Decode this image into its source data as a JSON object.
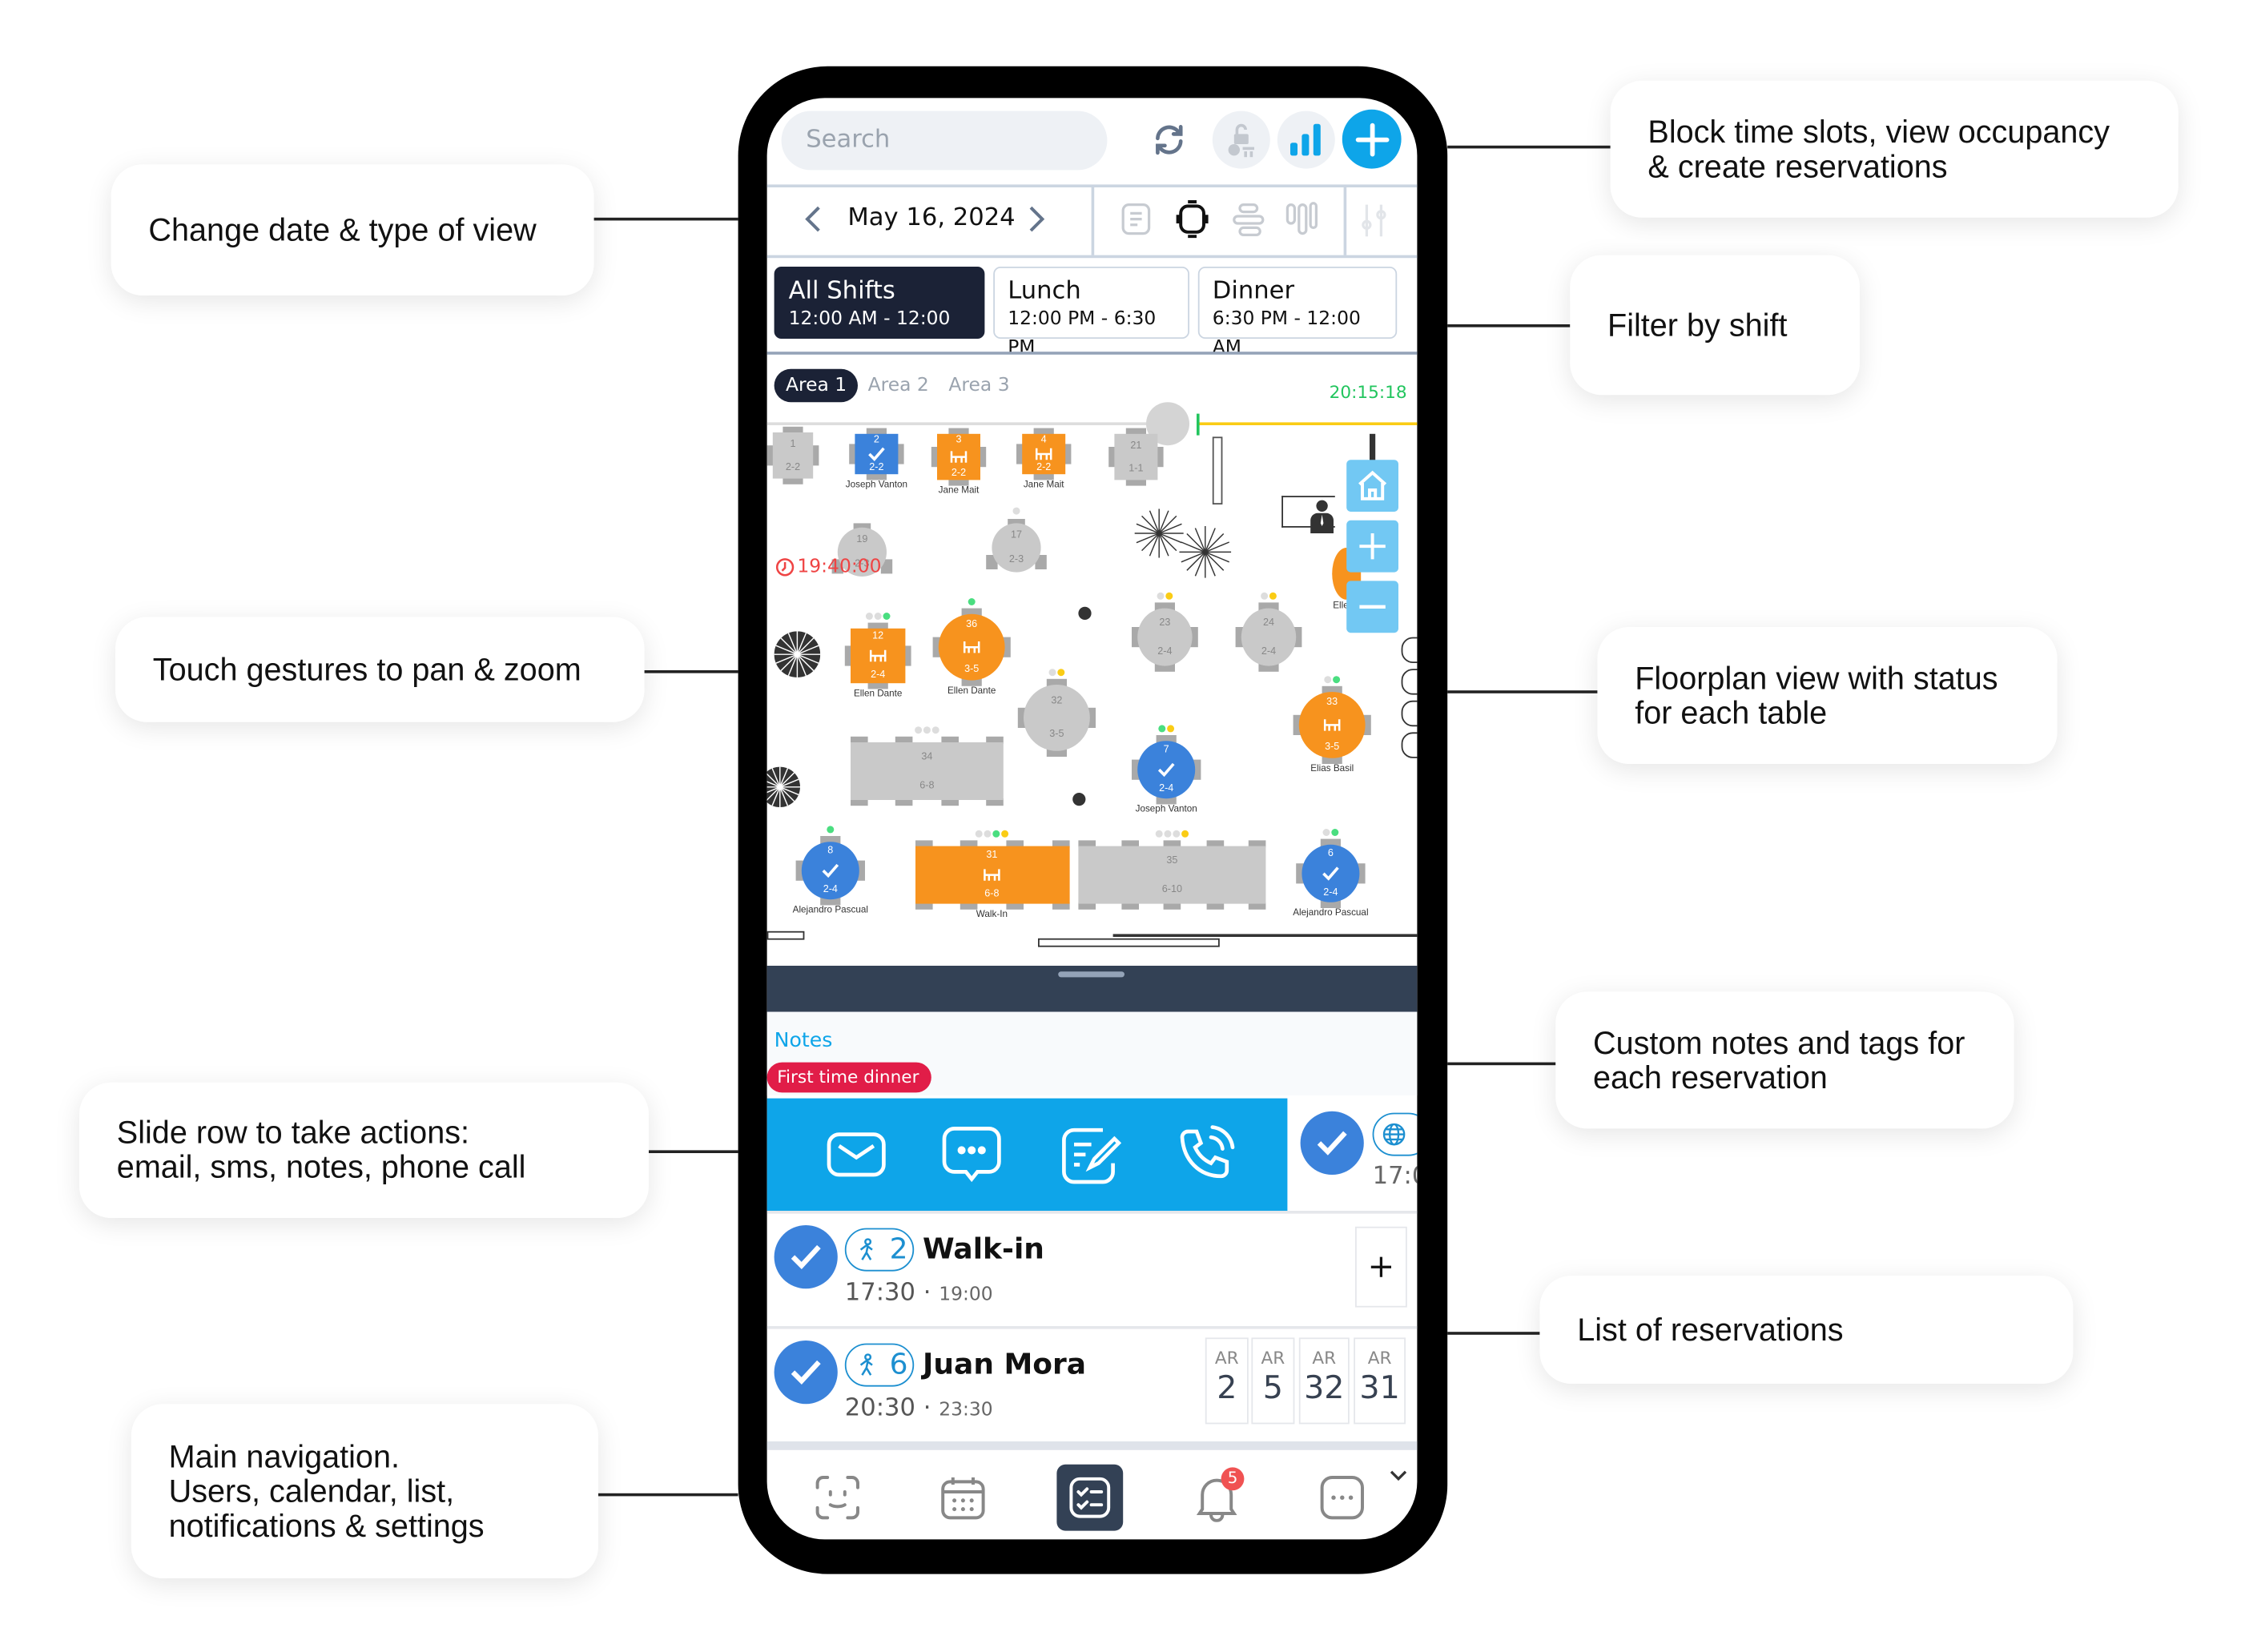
{
  "callouts": {
    "left": [
      {
        "text": "Change date & type of view"
      },
      {
        "text": "Touch gestures to pan & zoom"
      },
      {
        "text": "Slide row to take actions:\nemail, sms, notes, phone call"
      },
      {
        "text": "Main navigation.\nUsers, calendar, list,\nnotifications & settings"
      }
    ],
    "right": [
      {
        "text": "Block time slots, view occupancy\n& create reservations"
      },
      {
        "text": "Filter by shift"
      },
      {
        "text": "Floorplan view with status\nfor each table"
      },
      {
        "text": "Custom notes and tags for\neach reservation"
      },
      {
        "text": "List of reservations"
      }
    ]
  },
  "header": {
    "search_placeholder": "Search",
    "icons": [
      "refresh-icon",
      "block-time-icon",
      "occupancy-chart-icon",
      "add-reservation-icon"
    ]
  },
  "date_bar": {
    "date": "May 16, 2024",
    "views": [
      "list-view-icon",
      "floorplan-view-icon",
      "timeline-view-icon",
      "columns-view-icon",
      "filter-icon"
    ]
  },
  "shifts": [
    {
      "name": "All Shifts",
      "time": "12:00 AM - 12:00 AM",
      "active": true
    },
    {
      "name": "Lunch",
      "time": "12:00 PM - 6:30 PM",
      "active": false
    },
    {
      "name": "Dinner",
      "time": "6:30 PM - 12:00 AM",
      "active": false
    }
  ],
  "areas": [
    {
      "label": "Area 1",
      "active": true
    },
    {
      "label": "Area 2",
      "active": false
    },
    {
      "label": "Area 3",
      "active": false
    }
  ],
  "floorplan": {
    "current_time": "20:15:18",
    "timer": "19:40:00",
    "colors": {
      "seated": "#f7931e",
      "confirmed": "#3b82db",
      "free": "#c9c9c9",
      "now": "#22c55e",
      "timeline": "#facc15"
    },
    "partial_guest": "Elle",
    "tables": [
      {
        "number": "1",
        "capacity": "2-2",
        "status": "free",
        "guest": ""
      },
      {
        "number": "2",
        "capacity": "2-2",
        "status": "confirmed",
        "guest": "Joseph Vanton"
      },
      {
        "number": "3",
        "capacity": "2-2",
        "status": "seated",
        "guest": "Jane Mait"
      },
      {
        "number": "4",
        "capacity": "2-2",
        "status": "seated",
        "guest": "Jane Mait"
      },
      {
        "number": "21",
        "capacity": "1-1",
        "status": "free",
        "guest": ""
      },
      {
        "number": "19",
        "capacity": "2-3",
        "status": "free",
        "guest": ""
      },
      {
        "number": "17",
        "capacity": "2-3",
        "status": "free",
        "guest": ""
      },
      {
        "number": "12",
        "capacity": "2-4",
        "status": "seated",
        "guest": "Ellen Dante"
      },
      {
        "number": "36",
        "capacity": "3-5",
        "status": "seated",
        "guest": "Ellen Dante"
      },
      {
        "number": "23",
        "capacity": "2-4",
        "status": "free",
        "guest": ""
      },
      {
        "number": "24",
        "capacity": "2-4",
        "status": "free",
        "guest": ""
      },
      {
        "number": "32",
        "capacity": "3-5",
        "status": "free",
        "guest": ""
      },
      {
        "number": "33",
        "capacity": "3-5",
        "status": "seated",
        "guest": "Elias Basil"
      },
      {
        "number": "34",
        "capacity": "6-8",
        "status": "free",
        "guest": ""
      },
      {
        "number": "7",
        "capacity": "2-4",
        "status": "confirmed",
        "guest": "Joseph Vanton"
      },
      {
        "number": "8",
        "capacity": "2-4",
        "status": "confirmed",
        "guest": "Alejandro Pascual"
      },
      {
        "number": "31",
        "capacity": "6-8",
        "status": "seated",
        "guest": "Walk-In"
      },
      {
        "number": "35",
        "capacity": "6-10",
        "status": "free",
        "guest": ""
      },
      {
        "number": "6",
        "capacity": "2-4",
        "status": "confirmed",
        "guest": "Alejandro Pascual"
      }
    ],
    "zoom_controls": [
      "home-icon",
      "zoom-in-icon",
      "zoom-out-icon"
    ]
  },
  "sheet": {
    "notes_label": "Notes",
    "tag": "First time dinner",
    "tag_color": "#e11d48",
    "actions": [
      "email-icon",
      "sms-icon",
      "notes-icon",
      "phone-call-icon"
    ],
    "action_color": "#0ea5e9",
    "swiped_row_time": "17:0"
  },
  "reservations": [
    {
      "party": "2",
      "name": "Walk-in",
      "start": "17:30",
      "end": "19:00",
      "tables": []
    },
    {
      "party": "6",
      "name": "Juan Mora",
      "start": "20:30",
      "end": "23:30",
      "tables": [
        {
          "area": "AR",
          "num": "2"
        },
        {
          "area": "AR",
          "num": "5"
        },
        {
          "area": "AR",
          "num": "32"
        },
        {
          "area": "AR",
          "num": "31"
        }
      ]
    }
  ],
  "nav": {
    "items": [
      "users-icon",
      "calendar-icon",
      "list-icon",
      "notifications-icon",
      "settings-icon"
    ],
    "active": "list-icon",
    "notification_count": "5"
  }
}
